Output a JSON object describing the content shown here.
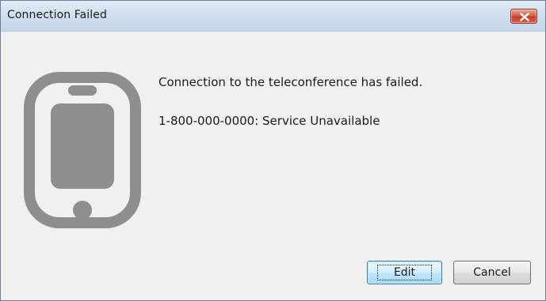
{
  "window": {
    "title": "Connection Failed"
  },
  "icons": {
    "close": "close-icon",
    "device": "smartphone-icon"
  },
  "colors": {
    "icon_gray": "#8e8e8e",
    "close_red": "#c94f38",
    "default_button_blue": "#3c7fb1"
  },
  "message": {
    "line1": "Connection to the teleconference has failed.",
    "line2": "1-800-000-0000: Service Unavailable"
  },
  "buttons": {
    "edit_label": "Edit",
    "cancel_label": "Cancel"
  }
}
